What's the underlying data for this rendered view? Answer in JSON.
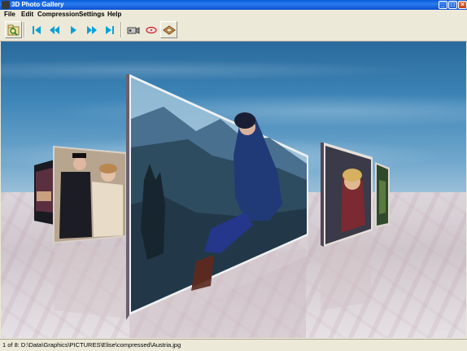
{
  "window": {
    "title": "3D Photo Gallery"
  },
  "menu": [
    "File",
    "Edit",
    "Compression",
    "Settings",
    "Help"
  ],
  "toolbar": {
    "buttons": [
      {
        "icon": "open-folder-icon"
      },
      {
        "icon": "first-photo-icon"
      },
      {
        "icon": "previous-photo-icon"
      },
      {
        "icon": "play-icon"
      },
      {
        "icon": "next-photo-icon"
      },
      {
        "icon": "last-photo-icon"
      },
      {
        "icon": "camera-icon"
      },
      {
        "icon": "ellipse-icon"
      },
      {
        "icon": "frame-icon"
      }
    ]
  },
  "gallery": {
    "photos": [
      {
        "name": "photo-far-left"
      },
      {
        "name": "photo-couple"
      },
      {
        "name": "photo-austria",
        "selected": true
      },
      {
        "name": "photo-child"
      },
      {
        "name": "photo-far-right"
      }
    ]
  },
  "status": {
    "text": "1 of 8: D:\\Data\\Graphics\\PICTURES\\Elise\\compressed\\Austria.jpg"
  },
  "colors": {
    "titlebar": "#0b4fcf",
    "sky": "#3f86b8",
    "floor": "#d2cfd3",
    "toolbar_icon": "#0aa0d8"
  }
}
